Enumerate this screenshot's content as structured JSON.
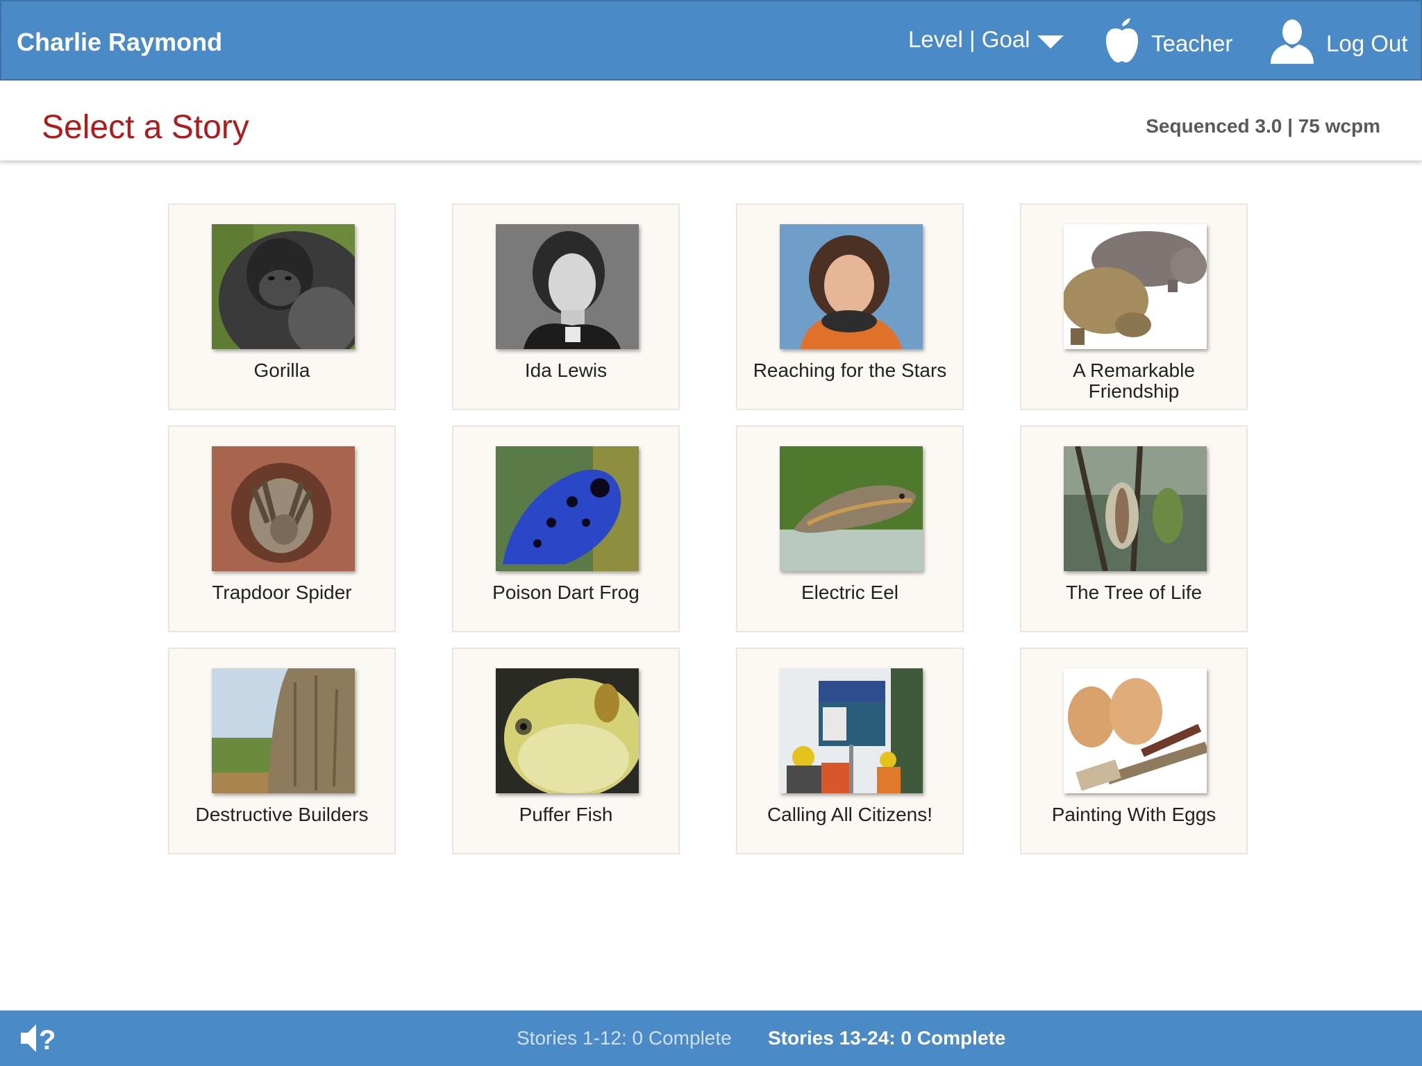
{
  "topbar": {
    "user_name": "Charlie Raymond",
    "level_goal": "Level | Goal",
    "teacher": "Teacher",
    "logout": "Log Out"
  },
  "header": {
    "title": "Select a Story",
    "level_info": "Sequenced 3.0 | 75 wcpm"
  },
  "stories": [
    {
      "title": "Gorilla"
    },
    {
      "title": "Ida Lewis"
    },
    {
      "title": "Reaching for the Stars"
    },
    {
      "title": "A Remarkable Friendship"
    },
    {
      "title": "Trapdoor Spider"
    },
    {
      "title": "Poison Dart Frog"
    },
    {
      "title": "Electric Eel"
    },
    {
      "title": "The Tree of Life"
    },
    {
      "title": "Destructive Builders"
    },
    {
      "title": "Puffer Fish"
    },
    {
      "title": "Calling All Citizens!"
    },
    {
      "title": "Painting With Eggs"
    }
  ],
  "footer": {
    "stories_1_12": "Stories 1-12: 0 Complete",
    "stories_13_24": "Stories 13-24: 0 Complete"
  },
  "colors": {
    "bar_blue": "#4a8ac7",
    "title_red": "#b01a1a",
    "card_bg": "#fcf8f4"
  }
}
